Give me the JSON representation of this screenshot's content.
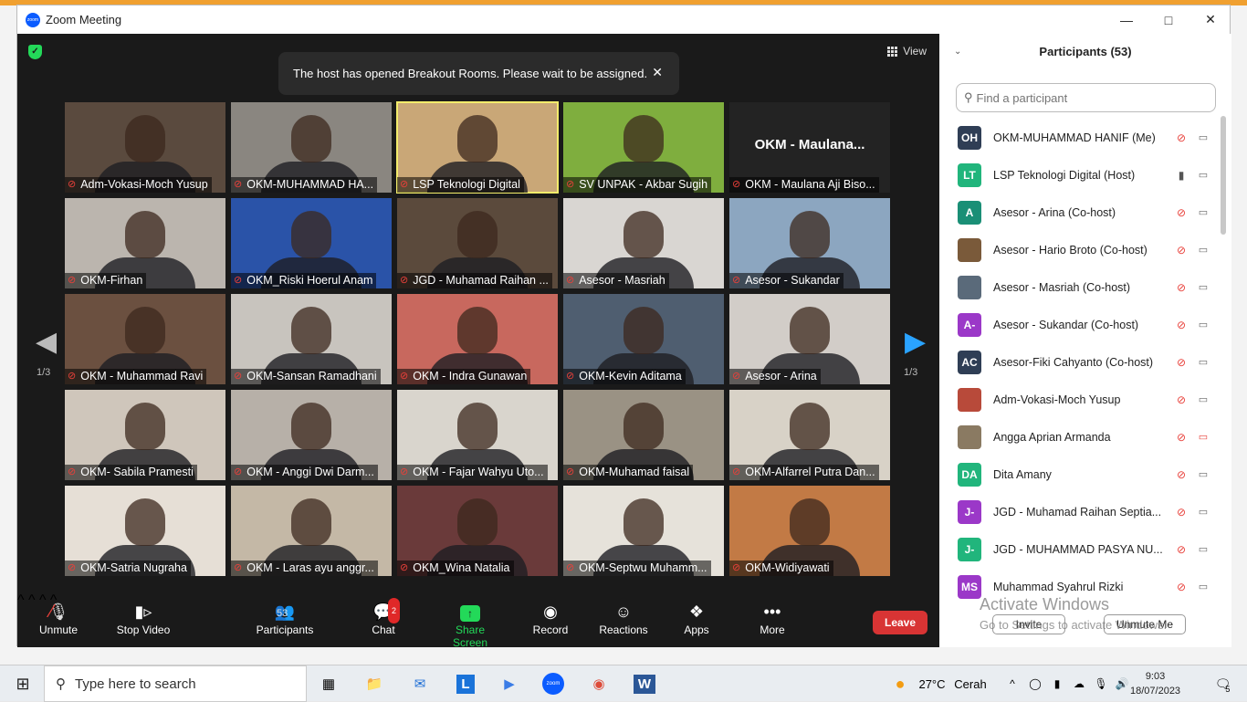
{
  "window": {
    "title": "Zoom Meeting"
  },
  "stage": {
    "view_label": "View",
    "toast": "The host has opened Breakout Rooms. Please wait to be assigned.",
    "page_left": "1/3",
    "page_right": "1/3",
    "tiles": [
      {
        "name": "Adm-Vokasi-Moch Yusup",
        "bg": "#5a4a3e"
      },
      {
        "name": "OKM-MUHAMMAD HA...",
        "bg": "#8a8680"
      },
      {
        "name": "LSP Teknologi Digital",
        "bg": "#c9a777",
        "active": true
      },
      {
        "name": "SV UNPAK - Akbar Sugih",
        "bg": "#7fae3e"
      },
      {
        "name": "OKM - Maulana Aji Biso...",
        "bg": "#232323",
        "big": "OKM - Maulana..."
      },
      {
        "name": "OKM-Firhan",
        "bg": "#bbb5ae"
      },
      {
        "name": "OKM_Riski Hoerul Anam",
        "bg": "#2a53a8"
      },
      {
        "name": "JGD - Muhamad Raihan ...",
        "bg": "#5b4a3c"
      },
      {
        "name": "Asesor - Masriah",
        "bg": "#d9d6d2"
      },
      {
        "name": "Asesor - Sukandar",
        "bg": "#8ca6c0"
      },
      {
        "name": "OKM - Muhammad Ravi",
        "bg": "#6b5040"
      },
      {
        "name": "OKM-Sansan Ramadhani",
        "bg": "#c8c4be"
      },
      {
        "name": "OKM - Indra Gunawan",
        "bg": "#c8685e"
      },
      {
        "name": "OKM-Kevin Aditama",
        "bg": "#4f5e70"
      },
      {
        "name": "Asesor - Arina",
        "bg": "#d2cdc8"
      },
      {
        "name": "OKM- Sabila Pramesti",
        "bg": "#cfc6bb"
      },
      {
        "name": "OKM - Anggi Dwi Darm...",
        "bg": "#b7b0a8"
      },
      {
        "name": "OKM - Fajar Wahyu Uto...",
        "bg": "#d9d5cd"
      },
      {
        "name": "OKM-Muhamad faisal",
        "bg": "#9a9284"
      },
      {
        "name": "OKM-Alfarrel Putra Dan...",
        "bg": "#d8d2c7"
      },
      {
        "name": "OKM-Satria Nugraha",
        "bg": "#e6dfd6"
      },
      {
        "name": "OKM - Laras ayu anggr...",
        "bg": "#c4b8a6"
      },
      {
        "name": "OKM_Wina Natalia",
        "bg": "#6a3a3a"
      },
      {
        "name": "OKM-Septwu Muhamm...",
        "bg": "#e6e2da"
      },
      {
        "name": "OKM-Widiyawati",
        "bg": "#c27a45"
      }
    ]
  },
  "toolbar": {
    "unmute": "Unmute",
    "stop_video": "Stop Video",
    "participants": "Participants",
    "participants_count": "53",
    "chat": "Chat",
    "chat_badge": "2",
    "share_screen": "Share Screen",
    "record": "Record",
    "reactions": "Reactions",
    "apps": "Apps",
    "more": "More",
    "leave": "Leave"
  },
  "panel": {
    "title": "Participants (53)",
    "search_placeholder": "Find a participant",
    "participants": [
      {
        "initials": "OH",
        "name": "OKM-MUHAMMAD HANIF (Me)",
        "color": "#2f3e55",
        "mic": "off",
        "cam": "off"
      },
      {
        "initials": "LT",
        "name": "LSP Teknologi Digital (Host)",
        "color": "#21b57c",
        "mic": "on",
        "cam": "off"
      },
      {
        "initials": "A",
        "name": "Asesor - Arina (Co-host)",
        "color": "#1a8f76",
        "mic": "off",
        "cam": "off"
      },
      {
        "initials": "",
        "name": "Asesor - Hario Broto (Co-host)",
        "color": "#7a5a3a",
        "mic": "off",
        "cam": "off"
      },
      {
        "initials": "",
        "name": "Asesor - Masriah (Co-host)",
        "color": "#5a6a7a",
        "mic": "off",
        "cam": "off"
      },
      {
        "initials": "A-",
        "name": "Asesor - Sukandar (Co-host)",
        "color": "#9b38c8",
        "mic": "off",
        "cam": "off"
      },
      {
        "initials": "AC",
        "name": "Asesor-Fiki Cahyanto (Co-host)",
        "color": "#2f3e55",
        "mic": "off",
        "cam": "off"
      },
      {
        "initials": "",
        "name": "Adm-Vokasi-Moch Yusup",
        "color": "#b84a3a",
        "mic": "off",
        "cam": "off"
      },
      {
        "initials": "",
        "name": "Angga Aprian Armanda",
        "color": "#8a7a62",
        "mic": "off",
        "cam": "disabled"
      },
      {
        "initials": "DA",
        "name": "Dita Amany",
        "color": "#21b57c",
        "mic": "off",
        "cam": "off"
      },
      {
        "initials": "J-",
        "name": "JGD - Muhamad Raihan Septia...",
        "color": "#9b38c8",
        "mic": "off",
        "cam": "off"
      },
      {
        "initials": "J-",
        "name": "JGD - MUHAMMAD PASYA NU...",
        "color": "#21b57c",
        "mic": "off",
        "cam": "off"
      },
      {
        "initials": "MS",
        "name": "Muhammad Syahrul Rizki",
        "color": "#9b38c8",
        "mic": "off",
        "cam": "off"
      }
    ],
    "invite": "Invite",
    "unmute_me": "Unmute Me"
  },
  "watermark": {
    "line1": "Activate Windows",
    "line2": "Go to Settings to activate Windows."
  },
  "taskbar": {
    "search_placeholder": "Type here to search",
    "weather_temp": "27°C",
    "weather_text": "Cerah",
    "time": "9:03",
    "date": "18/07/2023",
    "notifications": "5"
  }
}
